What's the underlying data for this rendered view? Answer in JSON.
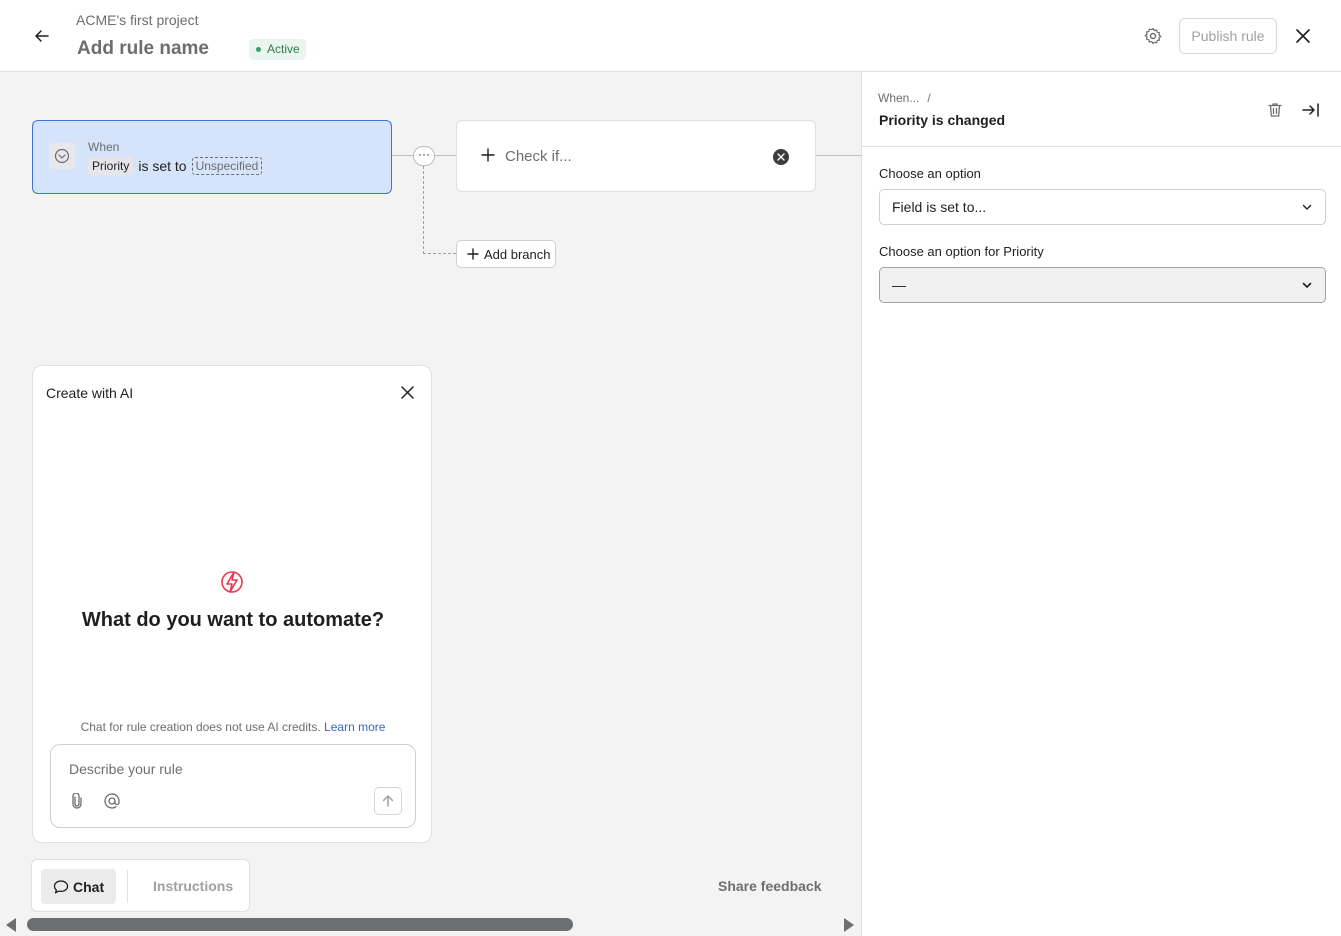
{
  "header": {
    "project_name": "ACME's first project",
    "rule_name": "Add rule name",
    "status": "Active",
    "publish_label": "Publish rule"
  },
  "canvas": {
    "trigger": {
      "when_label": "When",
      "field": "Priority",
      "connector": "is set to",
      "value": "Unspecified"
    },
    "check": {
      "label": "Check if..."
    },
    "add_branch_label": "Add branch"
  },
  "ai_panel": {
    "title": "Create with AI",
    "heading": "What do you want to automate?",
    "note": "Chat for rule creation does not use AI credits.",
    "learn_more": "Learn more",
    "input_placeholder": "Describe your rule"
  },
  "tabs": {
    "chat_label": "Chat",
    "instructions_label": "Instructions"
  },
  "share_feedback_label": "Share feedback",
  "side_panel": {
    "breadcrumb": "When...",
    "breadcrumb_separator": "/",
    "title": "Priority is changed",
    "option_label": "Choose an option",
    "option_value": "Field is set to...",
    "priority_label": "Choose an option for Priority",
    "priority_value": "—"
  },
  "colors": {
    "accent": "#4573d2",
    "trigger_bg": "#d6e4fb",
    "active_green": "#2f7a50",
    "bolt_red": "#e8384f"
  }
}
